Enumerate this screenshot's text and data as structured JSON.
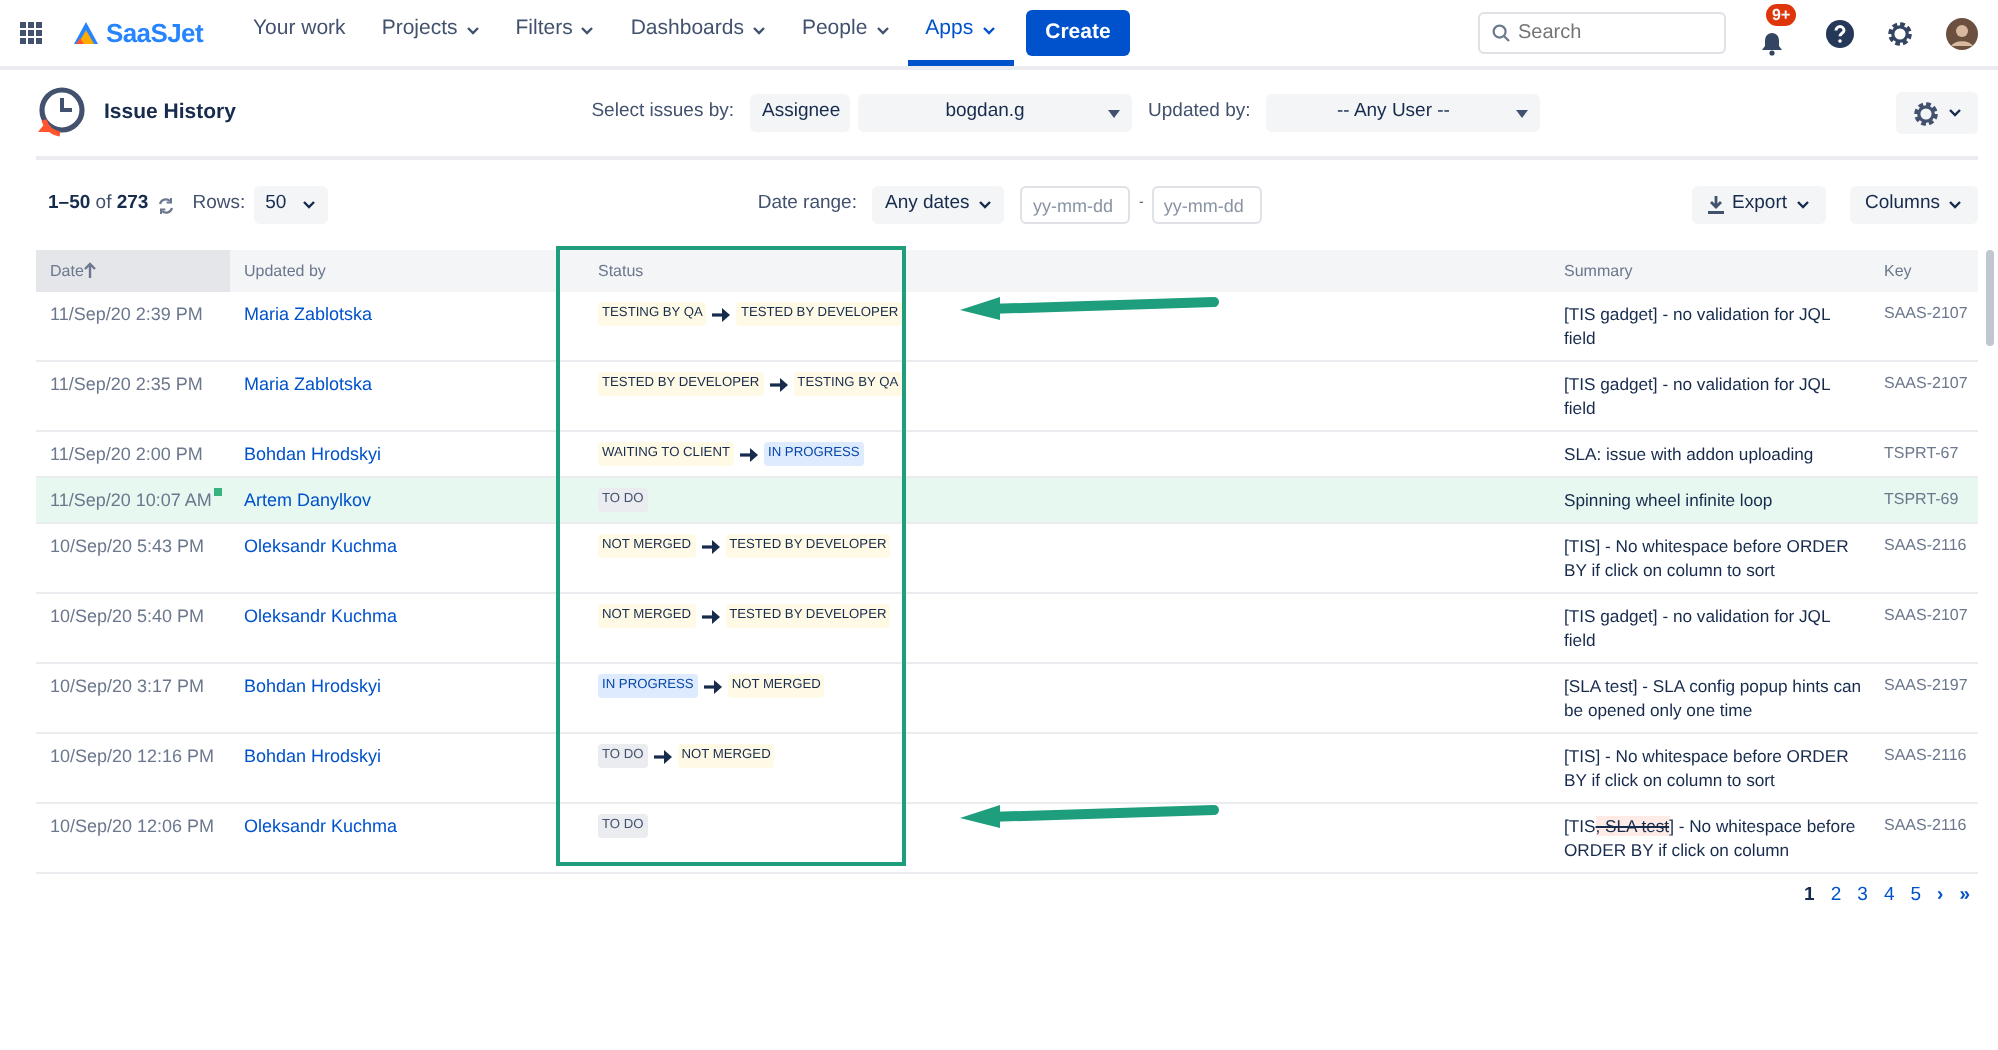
{
  "nav": {
    "logo": "SaaSJet",
    "items": [
      {
        "label": "Your work",
        "dropdown": false,
        "selected": false
      },
      {
        "label": "Projects",
        "dropdown": true,
        "selected": false
      },
      {
        "label": "Filters",
        "dropdown": true,
        "selected": false
      },
      {
        "label": "Dashboards",
        "dropdown": true,
        "selected": false
      },
      {
        "label": "People",
        "dropdown": true,
        "selected": false
      },
      {
        "label": "Apps",
        "dropdown": true,
        "selected": true
      }
    ],
    "create": "Create",
    "search": {
      "placeholder": "Search"
    },
    "notifications": "9+"
  },
  "header": {
    "title": "Issue History",
    "select_label": "Select issues by:",
    "select_by": "Assignee",
    "assignee": "bogdan.g",
    "updated_label": "Updated by:",
    "updated_by": "-- Any User --"
  },
  "toolbar": {
    "range": "**1–50** of **273**",
    "rows_label": "Rows:",
    "rows": "50",
    "date_label": "Date range:",
    "dates": "Any dates",
    "from": {
      "placeholder": "yy-mm-dd"
    },
    "separator": "-",
    "to": {
      "placeholder": "yy-mm-dd"
    },
    "export": "Export",
    "columns": "Columns"
  },
  "table": {
    "columns": [
      {
        "label": "Date",
        "sorted": true
      },
      {
        "label": "Updated by",
        "sorted": false
      },
      {
        "label": "Status",
        "sorted": false
      },
      {
        "label": "Summary",
        "sorted": false
      },
      {
        "label": "Key",
        "sorted": false
      }
    ],
    "rows": [
      {
        "date": "11/Sep/20 2:39 PM",
        "new": false,
        "user": "Maria Zablotska",
        "status": [
          {
            "text": "TESTING BY QA",
            "color": "#fffae6"
          },
          {
            "text": "TESTED BY DEVELOPER",
            "color": "#fffae6"
          }
        ],
        "summary": "[TIS gadget] - no validation for JQL field",
        "key": "SAAS-2107",
        "highlighted": false
      },
      {
        "date": "11/Sep/20 2:35 PM",
        "new": false,
        "user": "Maria Zablotska",
        "status": [
          {
            "text": "TESTED BY DEVELOPER",
            "color": "#fffae6"
          },
          {
            "text": "TESTING BY QA",
            "color": "#fffae6"
          }
        ],
        "summary": "[TIS gadget] - no validation for JQL field",
        "key": "SAAS-2107",
        "highlighted": false
      },
      {
        "date": "11/Sep/20 2:00 PM",
        "new": false,
        "user": "Bohdan Hrodskyi",
        "status": [
          {
            "text": "WAITING TO CLIENT",
            "color": "#fffae6"
          },
          {
            "text": "IN PROGRESS",
            "color": "#deebff"
          }
        ],
        "summary": "SLA: issue with addon uploading",
        "key": "TSPRT-67",
        "highlighted": false
      },
      {
        "date": "11/Sep/20 10:07 AM",
        "new": true,
        "user": "Artem Danylkov",
        "status": [
          {
            "text": "TO DO",
            "color": "#ebecf0"
          }
        ],
        "summary": "Spinning wheel infinite loop",
        "key": "TSPRT-69",
        "highlighted": true
      },
      {
        "date": "10/Sep/20 5:43 PM",
        "new": false,
        "user": "Oleksandr Kuchma",
        "status": [
          {
            "text": "NOT MERGED",
            "color": "#fffae6"
          },
          {
            "text": "TESTED BY DEVELOPER",
            "color": "#fffae6"
          }
        ],
        "summary": "[TIS] - No whitespace before ORDER BY if click on column to sort",
        "key": "SAAS-2116",
        "highlighted": false
      },
      {
        "date": "10/Sep/20 5:40 PM",
        "new": false,
        "user": "Oleksandr Kuchma",
        "status": [
          {
            "text": "NOT MERGED",
            "color": "#fffae6"
          },
          {
            "text": "TESTED BY DEVELOPER",
            "color": "#fffae6"
          }
        ],
        "summary": "[TIS gadget] - no validation for JQL field",
        "key": "SAAS-2107",
        "highlighted": false
      },
      {
        "date": "10/Sep/20 3:17 PM",
        "new": false,
        "user": "Bohdan Hrodskyi",
        "status": [
          {
            "text": "IN PROGRESS",
            "color": "#deebff"
          },
          {
            "text": "NOT MERGED",
            "color": "#fffae6"
          }
        ],
        "summary": "[SLA test] - SLA config popup hints can be opened only one time",
        "key": "SAAS-2197",
        "highlighted": false
      },
      {
        "date": "10/Sep/20 12:16 PM",
        "new": false,
        "user": "Bohdan Hrodskyi",
        "status": [
          {
            "text": "TO DO",
            "color": "#ebecf0"
          },
          {
            "text": "NOT MERGED",
            "color": "#fffae6"
          }
        ],
        "summary": "[TIS] - No whitespace before ORDER BY if click on column to sort",
        "key": "SAAS-2116",
        "highlighted": false
      },
      {
        "date": "10/Sep/20 12:06 PM",
        "new": false,
        "user": "Oleksandr Kuchma",
        "status": [
          {
            "text": "TO DO",
            "color": "#ebecf0"
          }
        ],
        "summary": [
          {
            "text": "[TIS",
            "deleted": false
          },
          {
            "text": ", SLA test",
            "deleted": true
          },
          {
            "text": "] - No whitespace before ORDER BY if click on column",
            "deleted": false
          }
        ],
        "key": "SAAS-2116",
        "highlighted": false
      }
    ]
  },
  "pagination": {
    "pages": [
      {
        "label": "1",
        "selected": true
      },
      {
        "label": "2",
        "selected": false
      },
      {
        "label": "3",
        "selected": false
      },
      {
        "label": "4",
        "selected": false
      },
      {
        "label": "5",
        "selected": false
      }
    ],
    "next": "›",
    "last": "»"
  },
  "annotations": [
    {
      "kind": "frame",
      "color": "#1e9e7c"
    },
    {
      "kind": "arrow",
      "color": "#1e9e7c"
    },
    {
      "kind": "arrow",
      "color": "#1e9e7c"
    }
  ]
}
